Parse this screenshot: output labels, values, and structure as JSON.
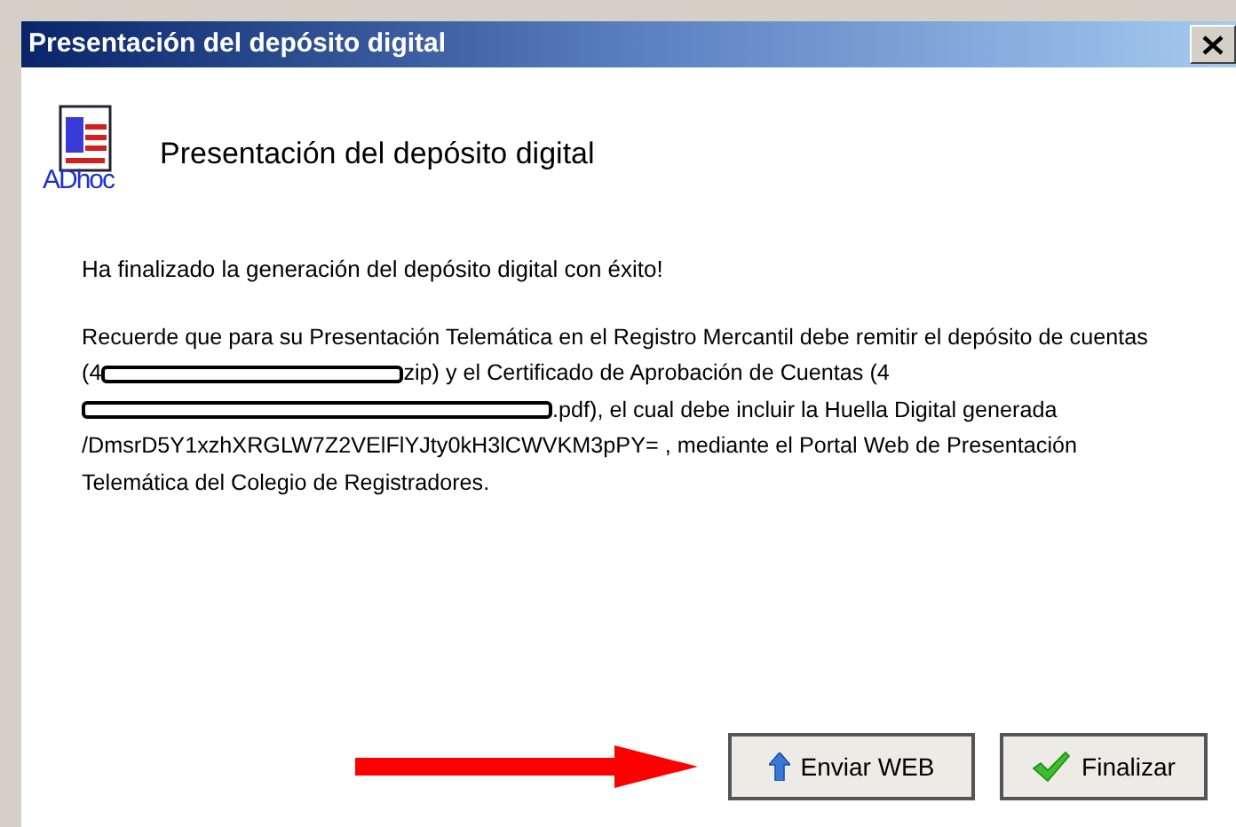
{
  "window": {
    "title": "Presentación del depósito digital"
  },
  "header": {
    "title": "Presentación del depósito digital",
    "logo_text": "ADhoc"
  },
  "message": "Ha finalizado la generación del depósito digital con éxito!",
  "paragraph": [
    {
      "kind": "text",
      "text": "Recuerde que para su Presentación Telemática en el Registro Mercantil debe remitir el depósito de cuentas (4"
    },
    {
      "kind": "redacted"
    },
    {
      "kind": "text",
      "text": "zip) y el Certificado de Aprobación de Cuentas (4"
    },
    {
      "kind": "redacted"
    },
    {
      "kind": "text",
      "text": ".pdf), el cual debe incluir la Huella Digital generada /DmsrD5Y1xzhXRGLW7Z2VElFlYJty0kH3lCWVKM3pPY= , mediante el Portal Web de Presentación Telemática del Colegio de Registradores."
    }
  ],
  "buttons": [
    {
      "kind": "upload",
      "label": "Enviar WEB"
    },
    {
      "kind": "check",
      "label": "Finalizar"
    }
  ]
}
